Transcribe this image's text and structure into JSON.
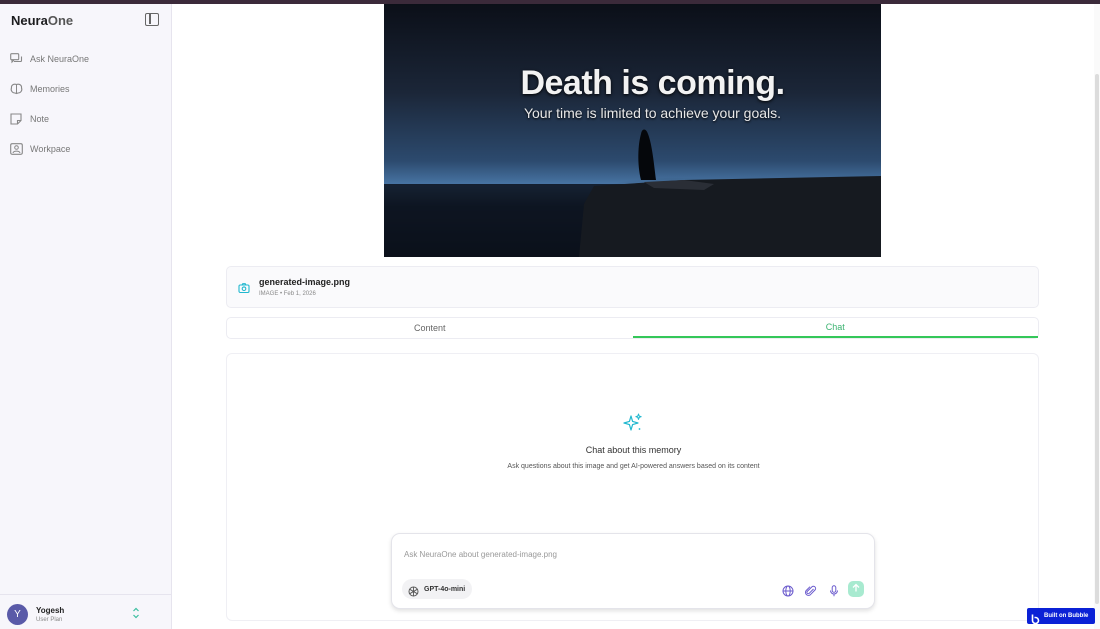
{
  "app": {
    "brand_main": "Neura",
    "brand_accent": "One"
  },
  "sidebar": {
    "items": [
      {
        "label": "Ask NeuraOne",
        "icon": "chat-bubbles-icon"
      },
      {
        "label": "Memories",
        "icon": "brain-icon"
      },
      {
        "label": "Note",
        "icon": "note-icon"
      },
      {
        "label": "Workpace",
        "icon": "workspace-icon"
      }
    ]
  },
  "user": {
    "initial": "Y",
    "name": "Yogesh",
    "plan": "User Plan"
  },
  "hero": {
    "title": "Death is coming.",
    "subtitle": "Your time is limited to achieve your goals."
  },
  "file": {
    "name": "generated-image.png",
    "meta": "IMAGE • Feb 1, 2026"
  },
  "tabs": {
    "content": "Content",
    "chat": "Chat",
    "active": "chat"
  },
  "chat": {
    "title": "Chat about this memory",
    "description": "Ask questions about this image and get AI-powered answers based on its content",
    "placeholder": "Ask NeuraOne about generated-image.png",
    "model": "GPT-4o-mini"
  },
  "badge": {
    "label": "Built on Bubble"
  },
  "colors": {
    "accent_green": "#34c759",
    "accent_cyan": "#22b8cf",
    "tool_purple": "#6a5acd",
    "badge_blue": "#0b21d6"
  }
}
